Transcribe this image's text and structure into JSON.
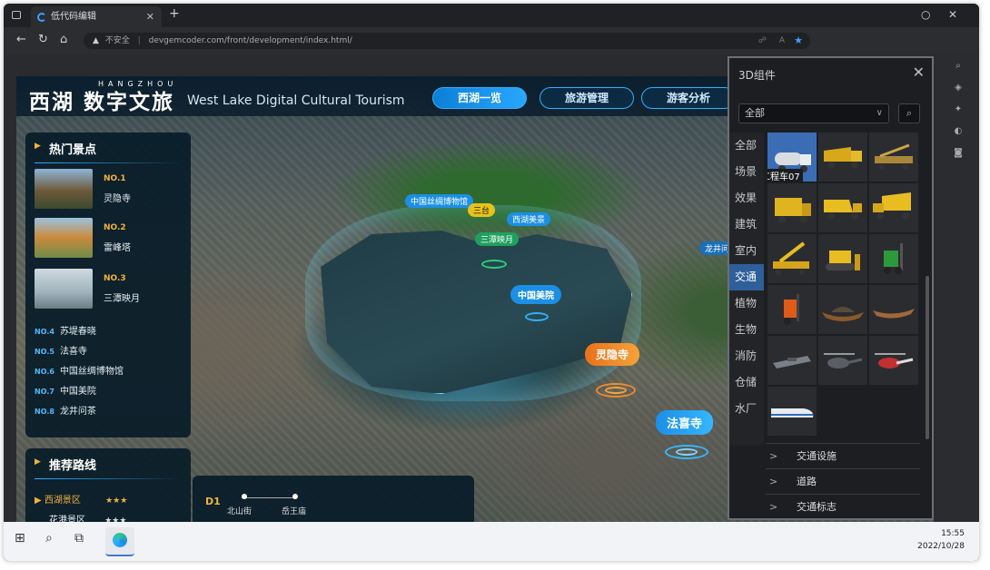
{
  "browser": {
    "tab_title": "低代码编辑",
    "url_warning": "不安全",
    "url": "devgemcoder.com/front/development/index.html/"
  },
  "app": {
    "logo_cn": "西湖",
    "logo_cn_bold": "数字文旅",
    "logo_en_top": "HANGZHOU",
    "logo_en": "West Lake Digital Cultural Tourism",
    "nav": [
      "西湖一览",
      "旅游管理",
      "游客分析"
    ]
  },
  "hot_spots": {
    "title": "热门景点",
    "items": [
      {
        "no": "NO.1",
        "name": "灵隐寺"
      },
      {
        "no": "NO.2",
        "name": "雷峰塔"
      },
      {
        "no": "NO.3",
        "name": "三潭映月"
      }
    ],
    "ranks": [
      {
        "no": "NO.4",
        "name": "苏堤春晓"
      },
      {
        "no": "NO.5",
        "name": "法喜寺"
      },
      {
        "no": "NO.6",
        "name": "中国丝绸博物馆"
      },
      {
        "no": "NO.7",
        "name": "中国美院"
      },
      {
        "no": "NO.8",
        "name": "龙井问茶"
      }
    ]
  },
  "routes": {
    "title": "推荐路线",
    "items": [
      {
        "name": "西湖景区",
        "stars": "★★★"
      },
      {
        "name": "花港景区",
        "stars": "★★★"
      }
    ]
  },
  "timeline": {
    "day": "D1",
    "stops": [
      "北山街",
      "岳王庙"
    ]
  },
  "markers": {
    "small": [
      "中国丝绸博物馆",
      "三台",
      "西湖美景",
      "三潭映月",
      "龙井问茶"
    ],
    "big": [
      "中国美院",
      "灵隐寺",
      "法喜寺"
    ]
  },
  "components": {
    "title": "3D组件",
    "select_value": "全部",
    "categories": [
      "全部",
      "场景",
      "效果",
      "建筑",
      "室内",
      "交通",
      "植物",
      "生物",
      "消防",
      "仓储",
      "水厂"
    ],
    "active_category": "交通",
    "tooltip": "工程车07",
    "subsections": [
      "交通设施",
      "道路",
      "交通标志"
    ]
  },
  "taskbar": {
    "time": "15:55",
    "date": "2022/10/28"
  },
  "colors": {
    "accent": "#2fb0ff",
    "gold": "#f0b43c",
    "active_cat": "#2f5f9a"
  }
}
